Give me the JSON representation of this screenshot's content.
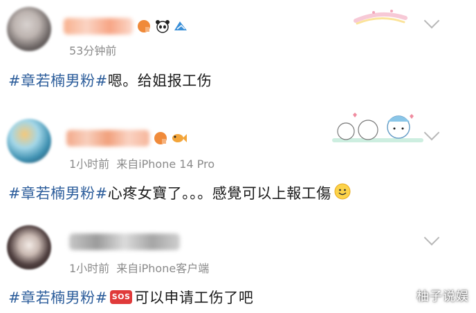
{
  "posts": [
    {
      "time": "53分钟前",
      "source": "",
      "hashtag": "#章若楠男粉#",
      "text": "嗯。给姐报工伤",
      "badges": [
        "vip-badge-icon",
        "panda-icon",
        "shark-icon"
      ]
    },
    {
      "time": "1小时前",
      "source": "来自iPhone 14 Pro",
      "hashtag": "#章若楠男粉#",
      "text": "心疼女寶了。。。感覺可以上報工傷",
      "badges": [
        "vip-badge-icon",
        "goldfish-icon"
      ]
    },
    {
      "time": "1小时前",
      "source": "来自iPhone客户端",
      "hashtag": "#章若楠男粉#",
      "sos": "SOS",
      "text": "可以申请工伤了吧"
    }
  ],
  "watermark": "柚子说娱",
  "colors": {
    "hashtag": "#2c5d9b",
    "meta": "#8a8a8a",
    "sos": "#e03a3a"
  }
}
